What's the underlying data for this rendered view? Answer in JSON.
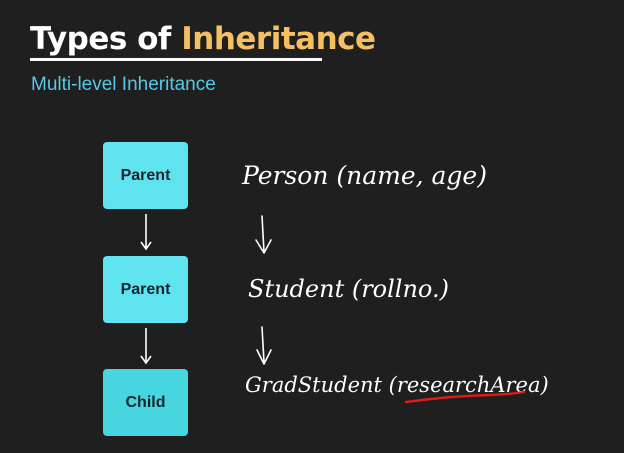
{
  "slide": {
    "title_main": "Types of ",
    "title_accent": "Inheritance",
    "subtitle": "Multi-level Inheritance",
    "colors": {
      "background": "#1f1f1f",
      "title_accent": "#f4c063",
      "subtitle": "#56c7e6",
      "box_fill": "#5fe3ef",
      "annotation_underline": "#e0191b"
    }
  },
  "diagram": {
    "boxes": [
      "Parent",
      "Parent",
      "Child"
    ]
  },
  "annotations": {
    "line1": "Person (name, age)",
    "line2": "Student (rollno.)",
    "line3": "GradStudent (researchArea)"
  }
}
